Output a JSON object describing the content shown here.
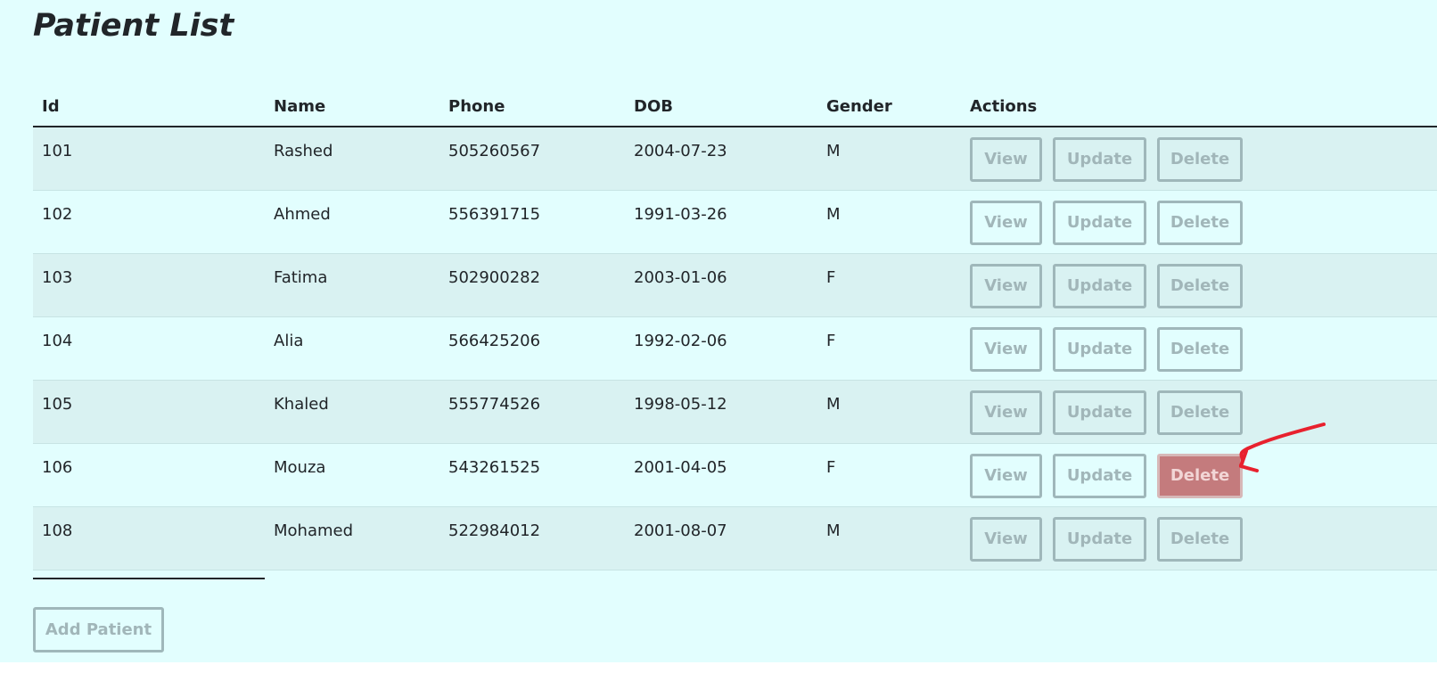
{
  "header": {
    "title": "Patient List"
  },
  "table": {
    "columns": [
      "Id",
      "Name",
      "Phone",
      "DOB",
      "Gender",
      "Actions"
    ],
    "rows": [
      {
        "id": "101",
        "name": "Rashed",
        "phone": "505260567",
        "dob": "2004-07-23",
        "gender": "M"
      },
      {
        "id": "102",
        "name": "Ahmed",
        "phone": "556391715",
        "dob": "1991-03-26",
        "gender": "M"
      },
      {
        "id": "103",
        "name": "Fatima",
        "phone": "502900282",
        "dob": "2003-01-06",
        "gender": "F"
      },
      {
        "id": "104",
        "name": "Alia",
        "phone": "566425206",
        "dob": "1992-02-06",
        "gender": "F"
      },
      {
        "id": "105",
        "name": "Khaled",
        "phone": "555774526",
        "dob": "1998-05-12",
        "gender": "M"
      },
      {
        "id": "106",
        "name": "Mouza",
        "phone": "543261525",
        "dob": "2001-04-05",
        "gender": "F"
      },
      {
        "id": "108",
        "name": "Mohamed",
        "phone": "522984012",
        "dob": "2001-08-07",
        "gender": "M"
      }
    ],
    "actions": {
      "view": "View",
      "update": "Update",
      "delete": "Delete"
    },
    "highlighted_delete_row": 5
  },
  "footer": {
    "add_button": "Add Patient"
  },
  "colors": {
    "background": "#e2fefe",
    "button_outline": "#9fb7ba",
    "delete_highlight": "#c47b7d",
    "annotation_arrow": "#e8212e"
  }
}
